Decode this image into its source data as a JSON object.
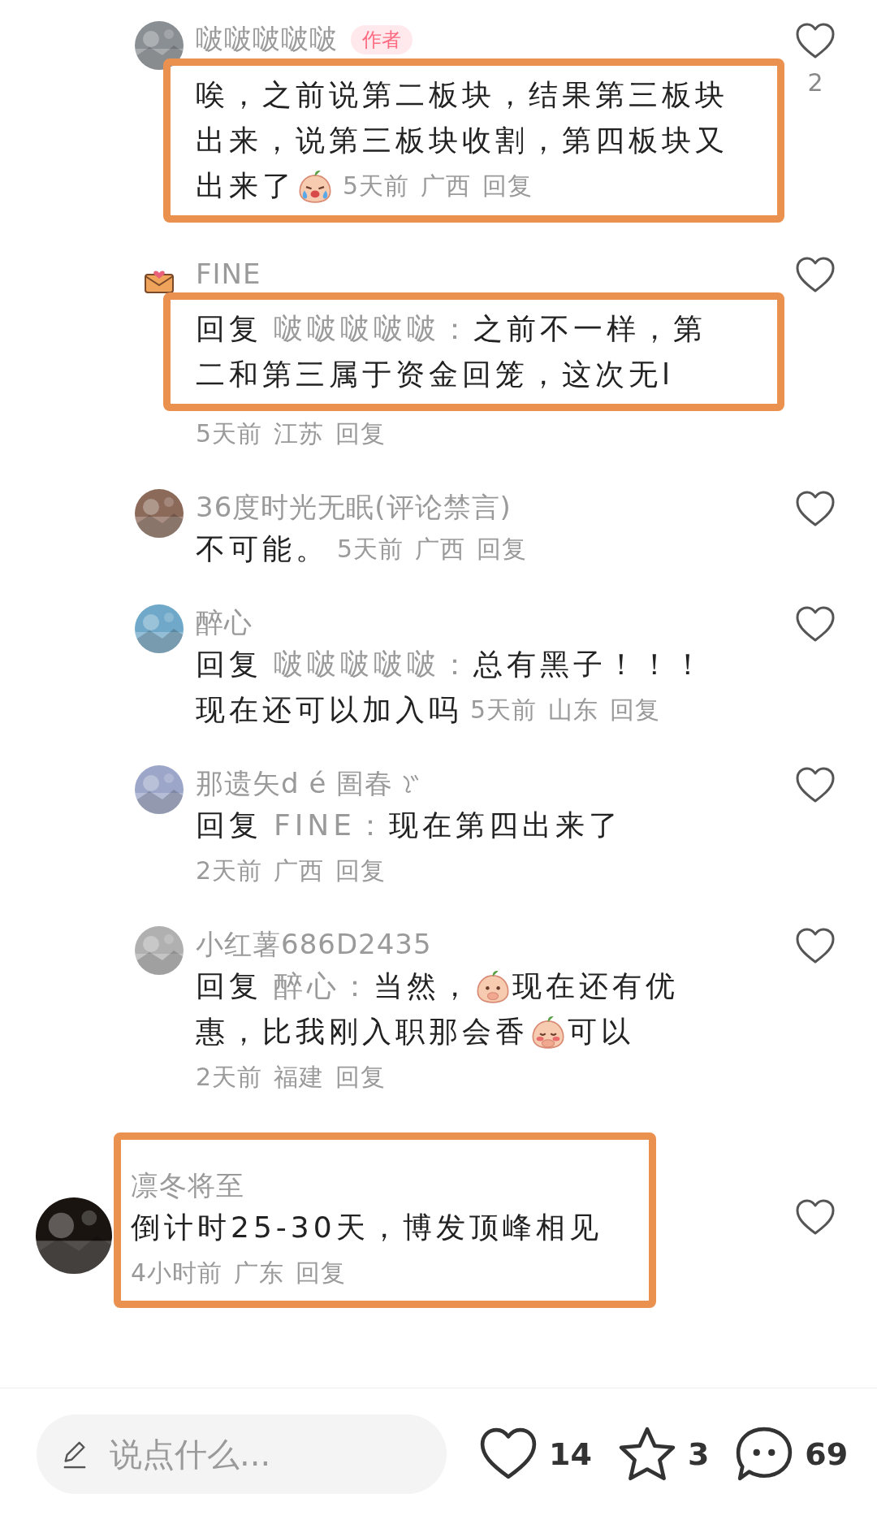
{
  "replies": [
    {
      "avatar": {
        "kind": "picture"
      },
      "name": "啵啵啵啵啵",
      "badge": "作者",
      "name_highlighted": false,
      "liked": false,
      "likes": "2",
      "lines": [
        {
          "highlighted": true,
          "parts": [
            {
              "kind": "text",
              "text": "唉，之前说第二板块，结果第三板块"
            }
          ]
        },
        {
          "highlighted": true,
          "parts": [
            {
              "kind": "text",
              "text": "出来，说第三板块收割，第四板块又"
            }
          ]
        },
        {
          "highlighted": true,
          "parts": [
            {
              "kind": "text",
              "text": "出来了"
            },
            {
              "kind": "crying-emoji"
            },
            {
              "kind": "time",
              "text": "5天前"
            },
            {
              "kind": "location",
              "text": "广西"
            },
            {
              "kind": "reply-link",
              "text": "回复"
            }
          ]
        }
      ]
    },
    {
      "avatar": {
        "kind": "envelope"
      },
      "name": "FINE",
      "name_highlighted": false,
      "liked": false,
      "lines": [
        {
          "highlighted": true,
          "parts": [
            {
              "kind": "reply",
              "text": "回复"
            },
            {
              "kind": "mention",
              "text": "啵啵啵啵啵："
            },
            {
              "kind": "text",
              "text": "之前不一样，第"
            }
          ]
        },
        {
          "highlighted": true,
          "parts": [
            {
              "kind": "text",
              "text": "二和第三属于资金回笼，这次无l"
            }
          ]
        },
        {
          "highlighted": false,
          "parts": [
            {
              "kind": "time",
              "text": "5天前"
            },
            {
              "kind": "location",
              "text": "江苏"
            },
            {
              "kind": "reply-link",
              "text": "回复"
            }
          ]
        }
      ]
    },
    {
      "avatar": {
        "kind": "picture"
      },
      "name": "36度时光无眠(评论禁言)",
      "name_highlighted": false,
      "liked": false,
      "lines": [
        {
          "highlighted": false,
          "parts": [
            {
              "kind": "text",
              "text": "不可能。"
            },
            {
              "kind": "time",
              "text": "5天前"
            },
            {
              "kind": "location",
              "text": "广西"
            },
            {
              "kind": "reply-link",
              "text": "回复"
            }
          ]
        }
      ]
    },
    {
      "avatar": {
        "kind": "picture"
      },
      "name": "醉心",
      "name_highlighted": false,
      "liked": false,
      "lines": [
        {
          "highlighted": false,
          "parts": [
            {
              "kind": "reply",
              "text": "回复"
            },
            {
              "kind": "mention",
              "text": "啵啵啵啵啵："
            },
            {
              "kind": "text",
              "text": "总有黑子！！！"
            }
          ]
        },
        {
          "highlighted": false,
          "parts": [
            {
              "kind": "text",
              "text": "现在还可以加入吗"
            },
            {
              "kind": "time",
              "text": "5天前"
            },
            {
              "kind": "location",
              "text": "山东"
            },
            {
              "kind": "reply-link",
              "text": "回复"
            }
          ]
        }
      ]
    },
    {
      "avatar": {
        "kind": "picture"
      },
      "name": "那遗矢d é 圄春",
      "name_icon": true,
      "name_highlighted": false,
      "liked": false,
      "lines": [
        {
          "highlighted": false,
          "parts": [
            {
              "kind": "reply",
              "text": "回复"
            },
            {
              "kind": "mention",
              "text": "FINE："
            },
            {
              "kind": "text",
              "text": "现在第四出来了"
            }
          ]
        },
        {
          "highlighted": false,
          "parts": [
            {
              "kind": "time",
              "text": "2天前"
            },
            {
              "kind": "location",
              "text": "广西"
            },
            {
              "kind": "reply-link",
              "text": "回复"
            }
          ]
        }
      ]
    },
    {
      "avatar": {
        "kind": "picture"
      },
      "name": "小红薯686D2435",
      "name_highlighted": false,
      "liked": false,
      "lines": [
        {
          "highlighted": false,
          "parts": [
            {
              "kind": "reply",
              "text": "回复"
            },
            {
              "kind": "mention",
              "text": "醉心："
            },
            {
              "kind": "text",
              "text": "当然，"
            },
            {
              "kind": "covering-emoji"
            },
            {
              "kind": "text",
              "text": "现在还有优"
            }
          ]
        },
        {
          "highlighted": false,
          "parts": [
            {
              "kind": "text",
              "text": "惠，比我刚入职那会香"
            },
            {
              "kind": "shy-emoji"
            },
            {
              "kind": "text",
              "text": "可以"
            }
          ]
        },
        {
          "highlighted": false,
          "parts": [
            {
              "kind": "time",
              "text": "2天前"
            },
            {
              "kind": "location",
              "text": "福建"
            },
            {
              "kind": "reply-link",
              "text": "回复"
            }
          ]
        }
      ]
    }
  ],
  "comments": [
    {
      "avatar": {
        "kind": "picture"
      },
      "name": "凛冬将至",
      "name_highlighted": true,
      "liked": false,
      "lines": [
        {
          "highlighted": true,
          "parts": [
            {
              "kind": "text",
              "text": "倒计时25-30天，博发顶峰相见"
            }
          ]
        },
        {
          "highlighted": true,
          "parts": [
            {
              "kind": "time",
              "text": "4小时前"
            },
            {
              "kind": "location",
              "text": "广东"
            },
            {
              "kind": "reply-link",
              "text": "回复"
            }
          ]
        }
      ]
    }
  ],
  "bottom_bar": {
    "input": {
      "placeholder": "说点什么..."
    },
    "actions": [
      {
        "kind": "like",
        "count": "14"
      },
      {
        "kind": "collect",
        "count": "3"
      },
      {
        "kind": "comment",
        "count": "69"
      }
    ]
  }
}
